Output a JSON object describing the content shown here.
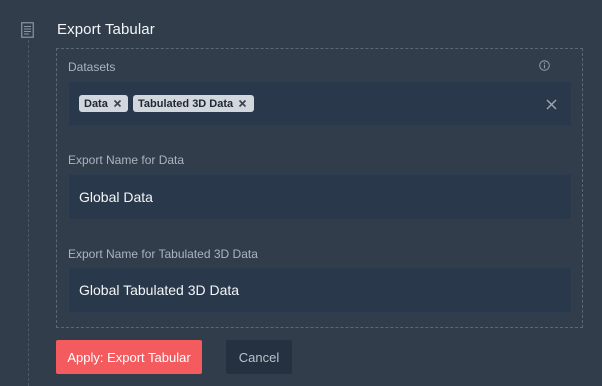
{
  "step": {
    "title": "Export Tabular",
    "icon": "document-icon"
  },
  "datasets": {
    "label": "Datasets",
    "info_icon": "info-icon",
    "chips": [
      {
        "label": "Data"
      },
      {
        "label": "Tabulated 3D Data"
      }
    ],
    "clear_icon": "close-icon"
  },
  "fields": [
    {
      "label": "Export Name for Data",
      "value": "Global Data"
    },
    {
      "label": "Export Name for Tabulated 3D Data",
      "value": "Global Tabulated 3D Data"
    }
  ],
  "actions": {
    "apply_label": "Apply: Export Tabular",
    "cancel_label": "Cancel"
  },
  "colors": {
    "background": "#313d4b",
    "input_bg": "#29384a",
    "accent": "#f35b5f",
    "chip_bg": "#d2d7dd"
  }
}
